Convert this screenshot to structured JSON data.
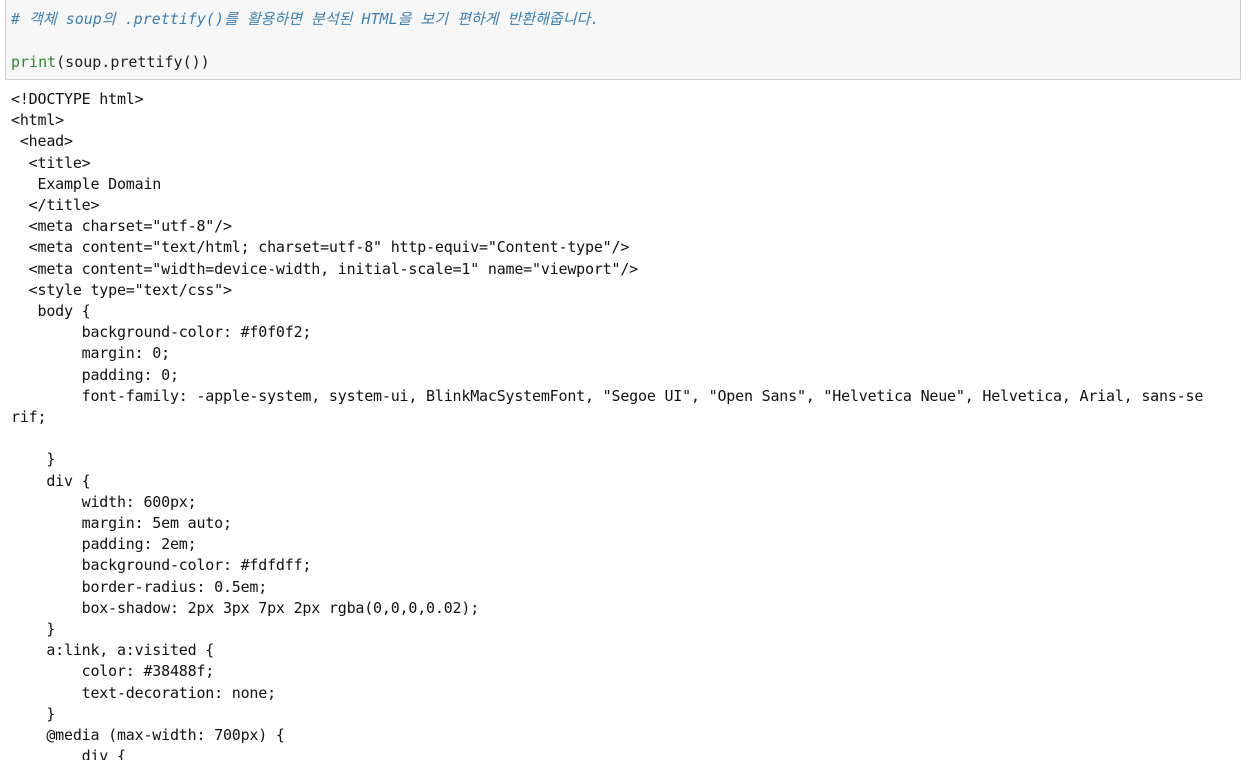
{
  "cell": {
    "comment": "# 객체 soup의 .prettify()를 활용하면 분석된 HTML을 보기 편하게 반환해줍니다.",
    "code_builtin": "print",
    "code_rest": "(soup.prettify())"
  },
  "output": {
    "lines": [
      "<!DOCTYPE html>",
      "<html>",
      " <head>",
      "  <title>",
      "   Example Domain",
      "  </title>",
      "  <meta charset=\"utf-8\"/>",
      "  <meta content=\"text/html; charset=utf-8\" http-equiv=\"Content-type\"/>",
      "  <meta content=\"width=device-width, initial-scale=1\" name=\"viewport\"/>",
      "  <style type=\"text/css\">",
      "   body {",
      "        background-color: #f0f0f2;",
      "        margin: 0;",
      "        padding: 0;",
      "        font-family: -apple-system, system-ui, BlinkMacSystemFont, \"Segoe UI\", \"Open Sans\", \"Helvetica Neue\", Helvetica, Arial, sans-se",
      "rif;",
      "",
      "    }",
      "    div {",
      "        width: 600px;",
      "        margin: 5em auto;",
      "        padding: 2em;",
      "        background-color: #fdfdff;",
      "        border-radius: 0.5em;",
      "        box-shadow: 2px 3px 7px 2px rgba(0,0,0,0.02);",
      "    }",
      "    a:link, a:visited {",
      "        color: #38488f;",
      "        text-decoration: none;",
      "    }",
      "    @media (max-width: 700px) {",
      "        div {"
    ]
  },
  "colors": {
    "comment": "#3d7fb0",
    "builtin": "#2a8a2a",
    "cell_background": "#f7f7f7",
    "cell_border": "#cfcfcf"
  }
}
